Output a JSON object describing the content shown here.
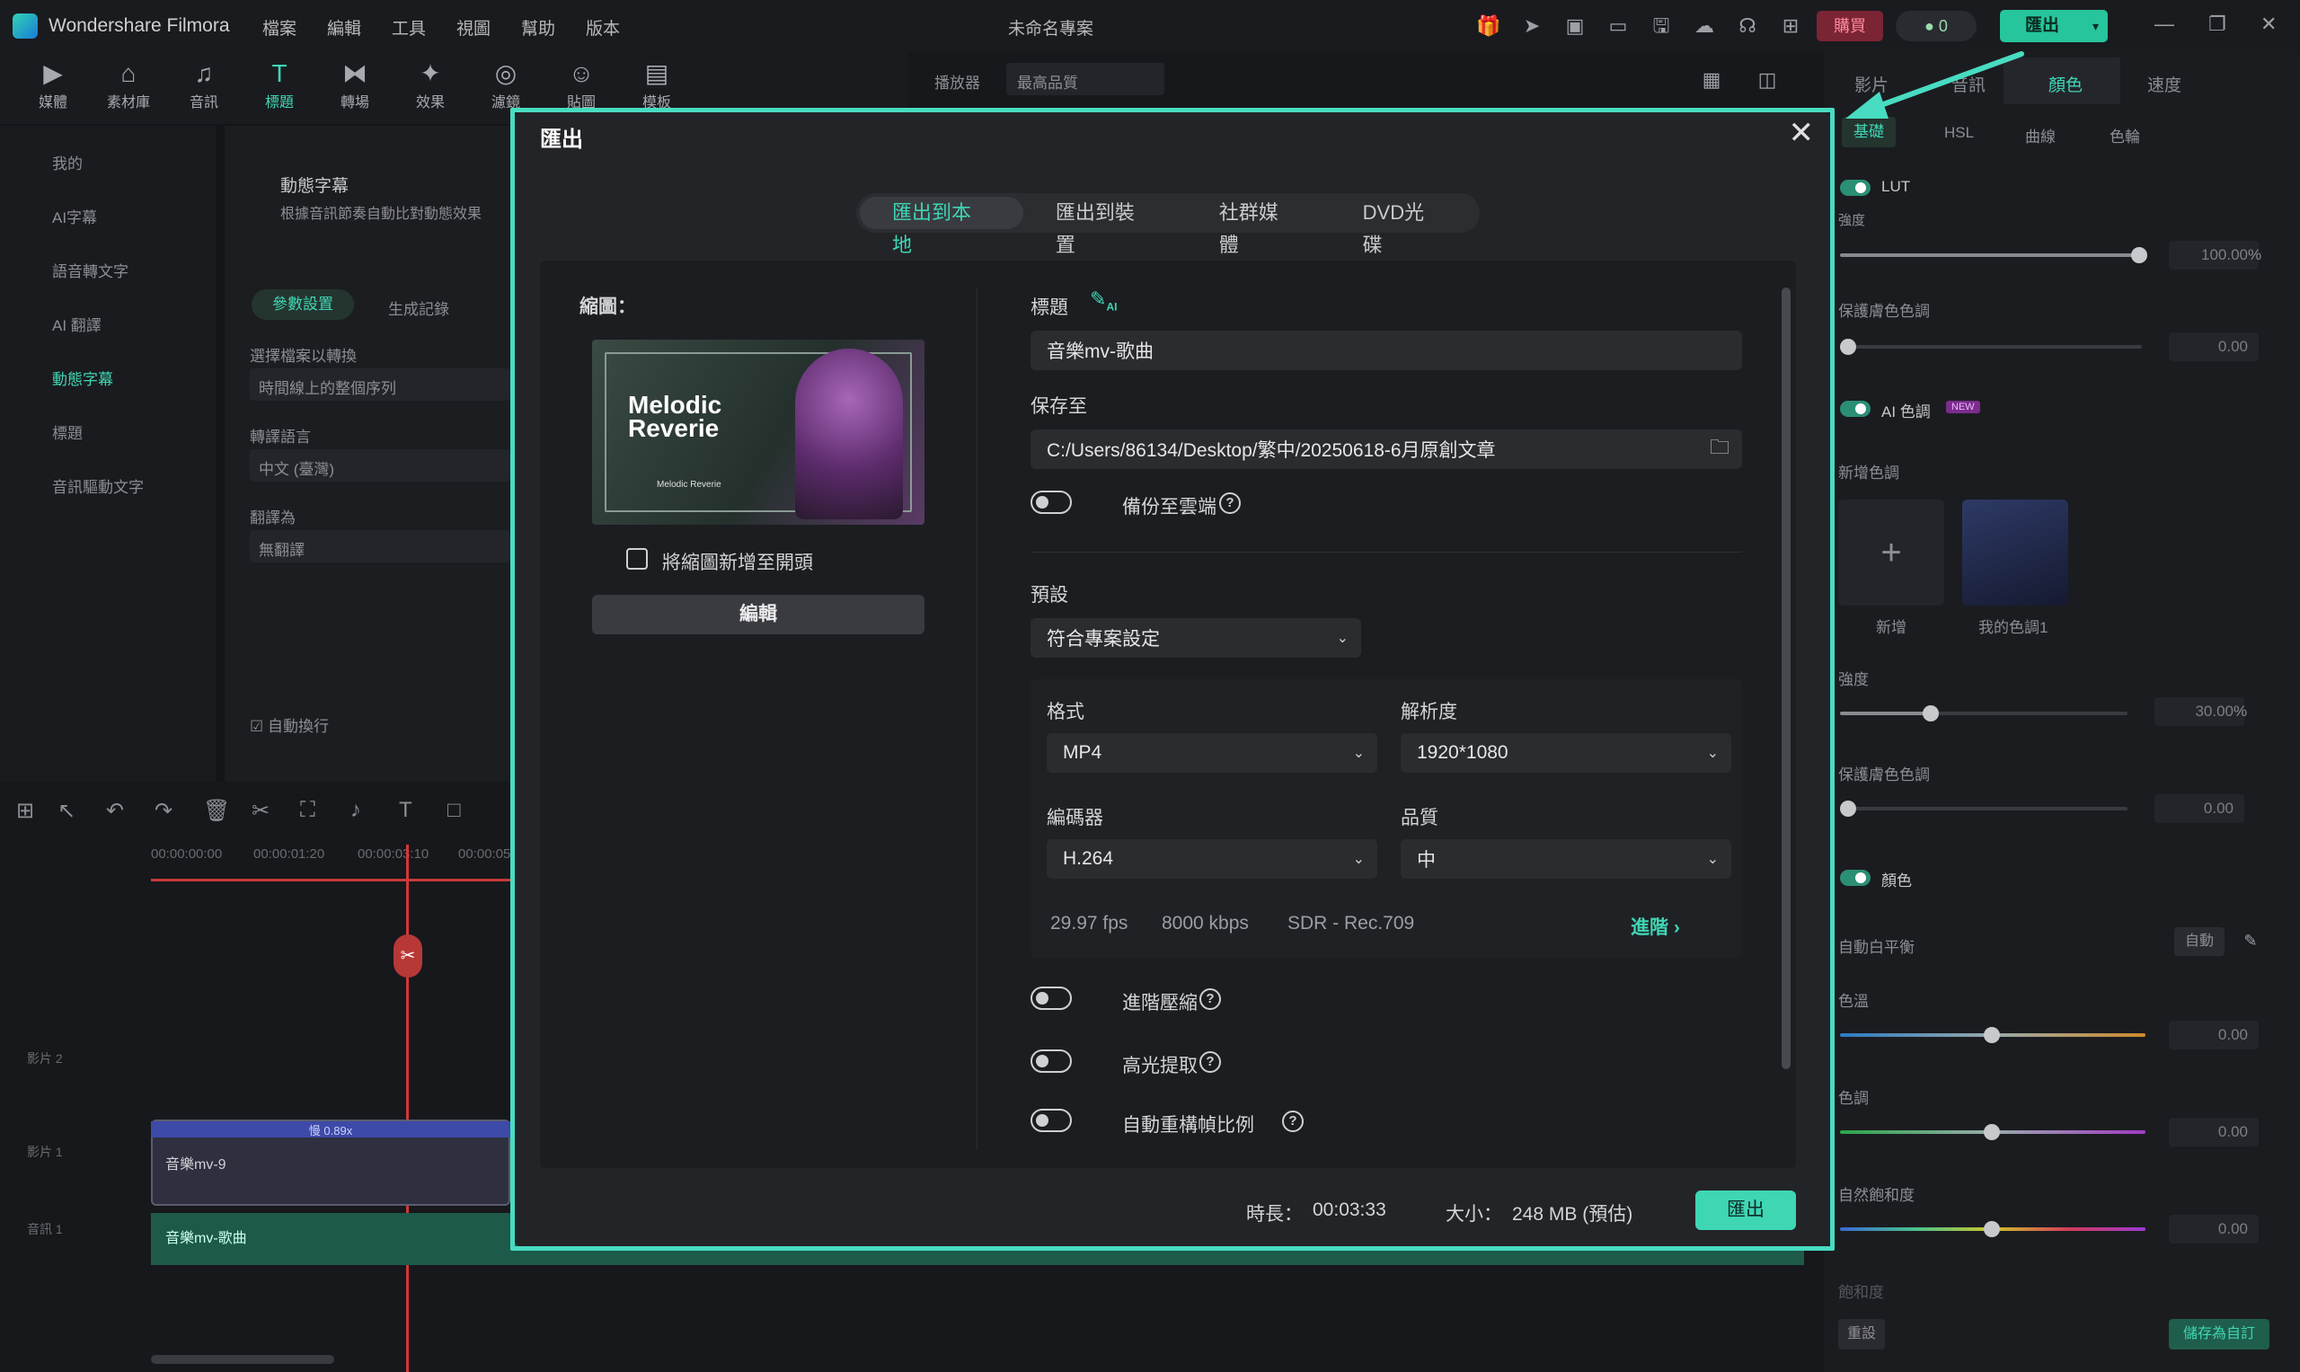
{
  "app": {
    "name": "Wondershare Filmora",
    "menus": [
      "檔案",
      "編輯",
      "工具",
      "視圖",
      "幫助",
      "版本"
    ],
    "project_title": "未命名專案",
    "buy_label": "購買",
    "credits": "0",
    "export_label": "匯出"
  },
  "toolbar": {
    "items": [
      {
        "label": "媒體"
      },
      {
        "label": "素材庫"
      },
      {
        "label": "音訊"
      },
      {
        "label": "標題"
      },
      {
        "label": "轉場"
      },
      {
        "label": "效果"
      },
      {
        "label": "濾鏡"
      },
      {
        "label": "貼圖"
      },
      {
        "label": "模板"
      }
    ]
  },
  "player": {
    "label": "播放器",
    "quality": "最高品質"
  },
  "left_nav": {
    "items": [
      "我的",
      "AI字幕",
      "語音轉文字",
      "AI 翻譯",
      "動態字幕",
      "標題",
      "音訊驅動文字"
    ]
  },
  "left_body": {
    "title": "動態字幕",
    "desc": "根據音訊節奏自動比對動態效果",
    "tab_params": "參數設置",
    "tab_history": "生成記錄",
    "select_label": "選擇檔案以轉換",
    "select_value": "時間線上的整個序列",
    "lang_label": "轉譯語言",
    "lang_value": "中文 (臺灣)",
    "translate_label": "翻譯為",
    "translate_value": "無翻譯",
    "auto_label": "自動換行"
  },
  "right_panel": {
    "tabs": [
      "影片",
      "音訊",
      "顏色",
      "速度"
    ],
    "subtabs": [
      "基礎",
      "HSL",
      "曲線",
      "色輪"
    ],
    "lut_label": "LUT",
    "strength_label": "強度",
    "strength_value": "100.00",
    "percent": "%",
    "protect_skin_label": "保護膚色色調",
    "protect_skin_value": "0.00",
    "ai_color_label": "AI 色調",
    "new_badge": "NEW",
    "add_palette_label": "新增色調",
    "add_label": "新增",
    "my_palette_label": "我的色調1",
    "ai_strength_label": "強度",
    "ai_strength_value": "30.00",
    "protect_skin2_label": "保護膚色色調",
    "protect_skin2_value": "0.00",
    "color_label": "顏色",
    "auto_wb_label": "自動白平衡",
    "auto_label": "自動",
    "temp_label": "色溫",
    "temp_value": "0.00",
    "tint_label": "色調",
    "tint_value": "0.00",
    "vibrance_label": "自然飽和度",
    "vibrance_value": "0.00",
    "saturation_label": "飽和度",
    "reset_label": "重設",
    "save_custom_label": "儲存為自訂"
  },
  "timeline": {
    "times": [
      "00:00:00:00",
      "00:00:01:20",
      "00:00:03:10",
      "00:00:05"
    ],
    "tracks": [
      "影片 2",
      "影片 1",
      "音訊 1"
    ],
    "speed_badge": "慢 0.89x",
    "video_clip": "音樂mv-9",
    "audio_clip": "音樂mv-歌曲"
  },
  "export_dialog": {
    "title": "匯出",
    "tabs": [
      "匯出到本地",
      "匯出到裝置",
      "社群媒體",
      "DVD光碟"
    ],
    "thumbnail_label": "縮圖：",
    "thumb_title_1": "Melodic",
    "thumb_title_2": "Reverie",
    "thumb_caption": "Melodic Reverie",
    "add_thumb_label": "將縮圖新增至開頭",
    "edit_label": "編輯",
    "title_label": "標題",
    "ai_tag": "AI",
    "title_value": "音樂mv-歌曲",
    "save_to_label": "保存至",
    "save_path": "C:/Users/86134/Desktop/繁中/20250618-6月原創文章",
    "cloud_backup_label": "備份至雲端",
    "preset_label": "預設",
    "preset_value": "符合專案設定",
    "format_label": "格式",
    "format_value": "MP4",
    "resolution_label": "解析度",
    "resolution_value": "1920*1080",
    "encoder_label": "編碼器",
    "encoder_value": "H.264",
    "quality_label": "品質",
    "quality_value": "中",
    "fps": "29.97 fps",
    "bitrate": "8000 kbps",
    "color_space": "SDR - Rec.709",
    "advanced_label": "進階",
    "adv_compress_label": "進階壓縮",
    "highlight_label": "高光提取",
    "auto_reframe_label": "自動重構幀比例",
    "duration_label": "時長：",
    "duration_value": "00:03:33",
    "size_label": "大小：",
    "size_value": "248 MB (預估)",
    "export_label": "匯出"
  }
}
